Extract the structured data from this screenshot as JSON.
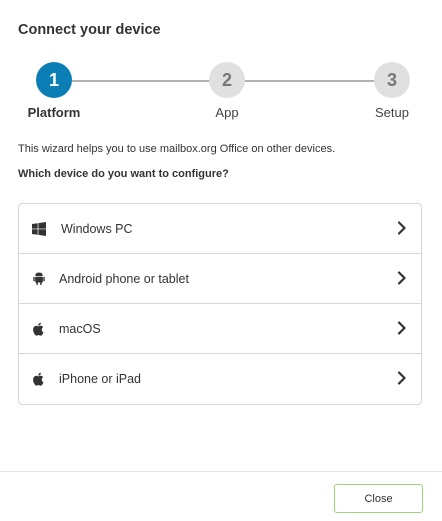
{
  "dialog": {
    "title": "Connect your device",
    "intro": "This wizard helps you to use mailbox.org Office on other devices.",
    "question": "Which device do you want to configure?",
    "close_label": "Close"
  },
  "stepper": {
    "active_step": 1,
    "steps": [
      {
        "number": "1",
        "label": "Platform"
      },
      {
        "number": "2",
        "label": "App"
      },
      {
        "number": "3",
        "label": "Setup"
      }
    ],
    "active_color": "#0b7fb5",
    "inactive_color": "#e0e0e0"
  },
  "devices": [
    {
      "label": "Windows PC",
      "icon": "windows-icon"
    },
    {
      "label": "Android phone or tablet",
      "icon": "android-icon"
    },
    {
      "label": "macOS",
      "icon": "apple-icon"
    },
    {
      "label": "iPhone or iPad",
      "icon": "apple-icon"
    }
  ],
  "colors": {
    "close_border": "#a3cf85"
  }
}
